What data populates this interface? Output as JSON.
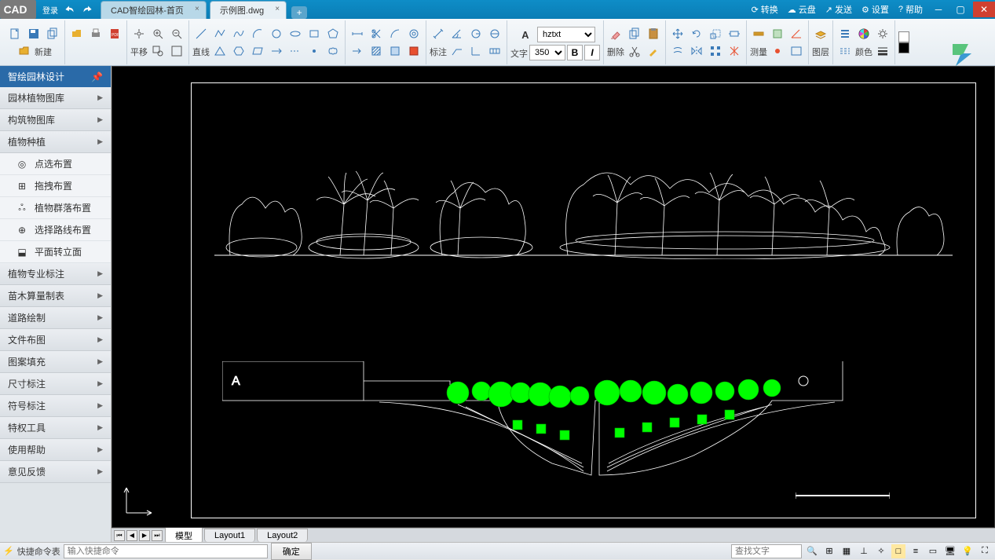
{
  "titlebar": {
    "logo": "CAD",
    "login": "登录",
    "tabs": [
      {
        "label": "CAD智绘园林-首页",
        "active": false
      },
      {
        "label": "示例图.dwg",
        "active": true
      }
    ],
    "right": {
      "convert": "转换",
      "cloud": "云盘",
      "send": "发送",
      "settings": "设置",
      "help": "帮助"
    }
  },
  "ribbon": {
    "new": "新建",
    "pan": "平移",
    "line": "直线",
    "annot": "标注",
    "text": "文字",
    "font": "hztxt",
    "size": "350",
    "delete": "删除",
    "measure": "测量",
    "layer": "图层",
    "color": "颜色"
  },
  "sidebar": {
    "header": "智绘园林设计",
    "items": [
      "园林植物图库",
      "构筑物图库",
      "植物种植"
    ],
    "subs": [
      "点选布置",
      "拖拽布置",
      "植物群落布置",
      "选择路线布置",
      "平面转立面"
    ],
    "items2": [
      "植物专业标注",
      "苗木算量制表",
      "道路绘制",
      "文件布图",
      "图案填充",
      "尺寸标注",
      "符号标注",
      "特权工具",
      "使用帮助",
      "意见反馈"
    ]
  },
  "layout_tabs": [
    "模型",
    "Layout1",
    "Layout2"
  ],
  "status": {
    "cmd_label": "快捷命令表",
    "cmd_placeholder": "输入快捷命令",
    "ok": "确定",
    "search_placeholder": "查找文字"
  },
  "canvas": {
    "label_a": "A"
  }
}
